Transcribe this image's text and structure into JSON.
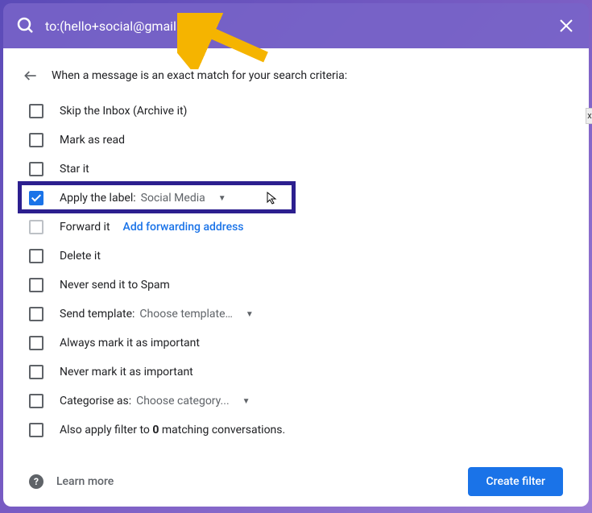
{
  "search": {
    "query": "to:(hello+social@gmail.com)"
  },
  "header": {
    "text": "When a message is an exact match for your search criteria:"
  },
  "options": {
    "skip_inbox": "Skip the Inbox (Archive it)",
    "mark_read": "Mark as read",
    "star": "Star it",
    "apply_label": "Apply the label:",
    "apply_label_value": "Social Media",
    "forward": "Forward it",
    "forward_link": "Add forwarding address",
    "delete": "Delete it",
    "never_spam": "Never send it to Spam",
    "send_template": "Send template:",
    "send_template_value": "Choose template…",
    "mark_important": "Always mark it as important",
    "never_important": "Never mark it as important",
    "categorise": "Categorise as:",
    "categorise_value": "Choose category...",
    "also_apply_prefix": "Also apply filter to ",
    "also_apply_count": "0",
    "also_apply_suffix": " matching conversations."
  },
  "footer": {
    "learn_more": "Learn more",
    "create_filter": "Create filter"
  },
  "peek": "x"
}
